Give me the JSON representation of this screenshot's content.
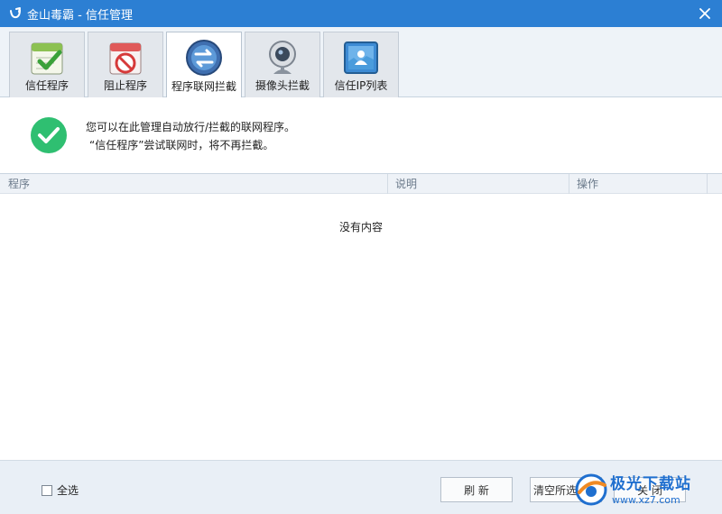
{
  "window": {
    "title": "金山毒霸 - 信任管理",
    "accent_color": "#2c7fd3"
  },
  "tabs": [
    {
      "label": "信任程序",
      "icon": "trusted-programs-icon",
      "active": false
    },
    {
      "label": "阻止程序",
      "icon": "blocked-programs-icon",
      "active": false
    },
    {
      "label": "程序联网拦截",
      "icon": "network-block-icon",
      "active": true
    },
    {
      "label": "摄像头拦截",
      "icon": "webcam-icon",
      "active": false
    },
    {
      "label": "信任IP列表",
      "icon": "trusted-ip-icon",
      "active": false
    }
  ],
  "info": {
    "line1": "您可以在此管理自动放行/拦截的联网程序。",
    "line2": "“信任程序”尝试联网时，将不再拦截。",
    "status_color": "#2fbf71"
  },
  "table": {
    "columns": [
      "程序",
      "说明",
      "操作"
    ],
    "rows": [],
    "empty_text": "没有内容"
  },
  "footer": {
    "select_all_label": "全选",
    "refresh_label": "刷 新",
    "clear_selected_label": "清空所选程序",
    "close_label": "关 闭"
  },
  "watermark": {
    "text": "极光下载站",
    "url": "www.xz7.com"
  }
}
